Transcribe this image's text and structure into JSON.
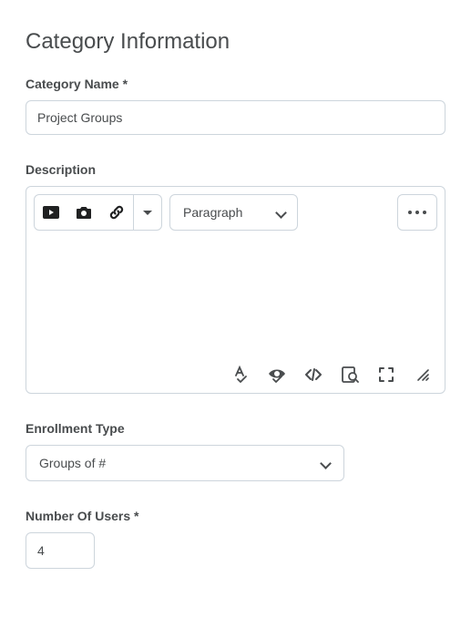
{
  "page": {
    "title": "Category Information"
  },
  "category_name": {
    "label": "Category Name *",
    "value": "Project Groups"
  },
  "description": {
    "label": "Description",
    "toolbar": {
      "format_label": "Paragraph"
    },
    "value": ""
  },
  "enrollment_type": {
    "label": "Enrollment Type",
    "selected": "Groups of #"
  },
  "number_of_users": {
    "label": "Number Of Users *",
    "value": "4"
  },
  "icons": {
    "video": "video-icon",
    "camera": "camera-icon",
    "link": "link-icon",
    "dropdown": "caret-down-icon",
    "more": "ellipsis-icon",
    "spellcheck": "spellcheck-icon",
    "accessibility": "accessibility-icon",
    "code": "code-icon",
    "preview": "preview-icon",
    "fullscreen": "fullscreen-icon",
    "resize": "resize-icon"
  }
}
